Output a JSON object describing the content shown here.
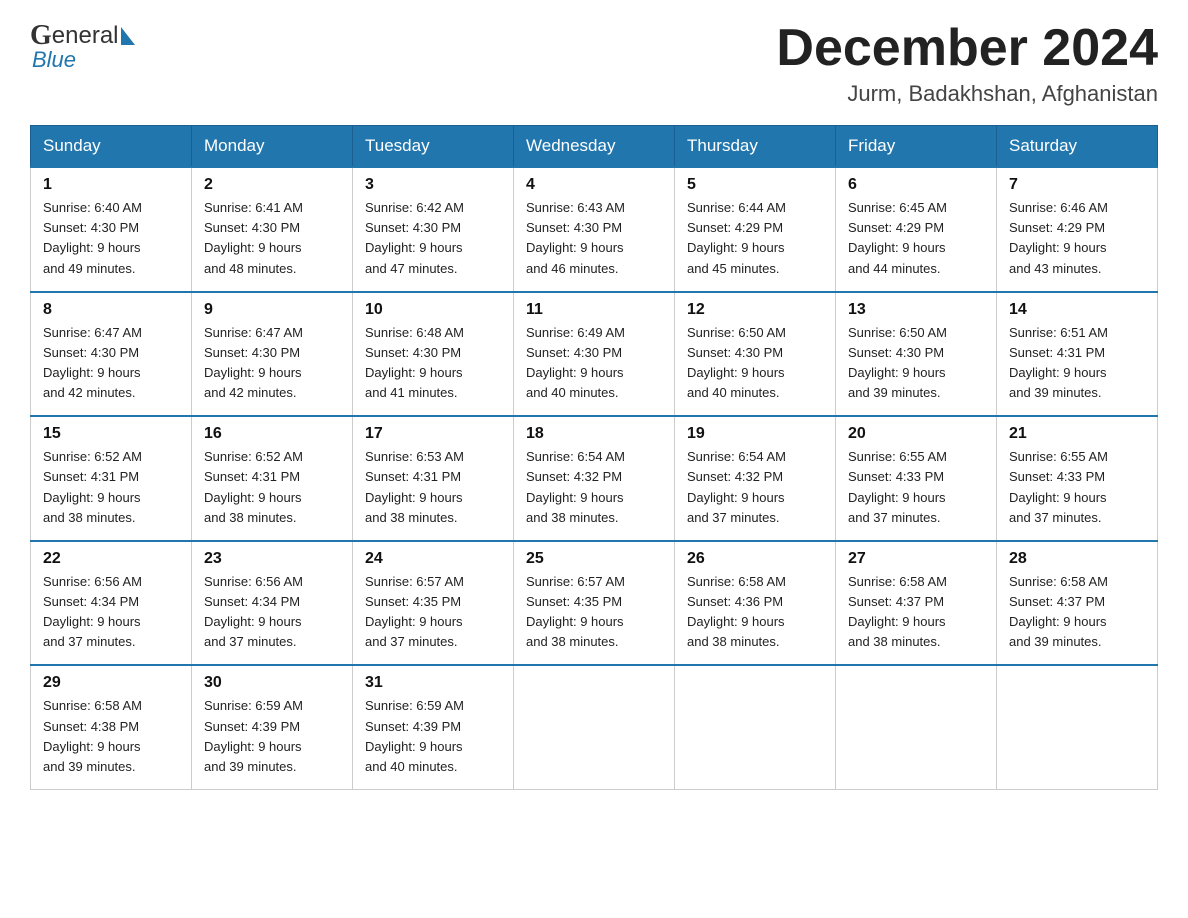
{
  "header": {
    "month_year": "December 2024",
    "location": "Jurm, Badakhshan, Afghanistan",
    "logo_general": "General",
    "logo_blue": "Blue"
  },
  "days_of_week": [
    "Sunday",
    "Monday",
    "Tuesday",
    "Wednesday",
    "Thursday",
    "Friday",
    "Saturday"
  ],
  "weeks": [
    [
      {
        "date": "1",
        "sunrise": "6:40 AM",
        "sunset": "4:30 PM",
        "daylight": "9 hours and 49 minutes."
      },
      {
        "date": "2",
        "sunrise": "6:41 AM",
        "sunset": "4:30 PM",
        "daylight": "9 hours and 48 minutes."
      },
      {
        "date": "3",
        "sunrise": "6:42 AM",
        "sunset": "4:30 PM",
        "daylight": "9 hours and 47 minutes."
      },
      {
        "date": "4",
        "sunrise": "6:43 AM",
        "sunset": "4:30 PM",
        "daylight": "9 hours and 46 minutes."
      },
      {
        "date": "5",
        "sunrise": "6:44 AM",
        "sunset": "4:29 PM",
        "daylight": "9 hours and 45 minutes."
      },
      {
        "date": "6",
        "sunrise": "6:45 AM",
        "sunset": "4:29 PM",
        "daylight": "9 hours and 44 minutes."
      },
      {
        "date": "7",
        "sunrise": "6:46 AM",
        "sunset": "4:29 PM",
        "daylight": "9 hours and 43 minutes."
      }
    ],
    [
      {
        "date": "8",
        "sunrise": "6:47 AM",
        "sunset": "4:30 PM",
        "daylight": "9 hours and 42 minutes."
      },
      {
        "date": "9",
        "sunrise": "6:47 AM",
        "sunset": "4:30 PM",
        "daylight": "9 hours and 42 minutes."
      },
      {
        "date": "10",
        "sunrise": "6:48 AM",
        "sunset": "4:30 PM",
        "daylight": "9 hours and 41 minutes."
      },
      {
        "date": "11",
        "sunrise": "6:49 AM",
        "sunset": "4:30 PM",
        "daylight": "9 hours and 40 minutes."
      },
      {
        "date": "12",
        "sunrise": "6:50 AM",
        "sunset": "4:30 PM",
        "daylight": "9 hours and 40 minutes."
      },
      {
        "date": "13",
        "sunrise": "6:50 AM",
        "sunset": "4:30 PM",
        "daylight": "9 hours and 39 minutes."
      },
      {
        "date": "14",
        "sunrise": "6:51 AM",
        "sunset": "4:31 PM",
        "daylight": "9 hours and 39 minutes."
      }
    ],
    [
      {
        "date": "15",
        "sunrise": "6:52 AM",
        "sunset": "4:31 PM",
        "daylight": "9 hours and 38 minutes."
      },
      {
        "date": "16",
        "sunrise": "6:52 AM",
        "sunset": "4:31 PM",
        "daylight": "9 hours and 38 minutes."
      },
      {
        "date": "17",
        "sunrise": "6:53 AM",
        "sunset": "4:31 PM",
        "daylight": "9 hours and 38 minutes."
      },
      {
        "date": "18",
        "sunrise": "6:54 AM",
        "sunset": "4:32 PM",
        "daylight": "9 hours and 38 minutes."
      },
      {
        "date": "19",
        "sunrise": "6:54 AM",
        "sunset": "4:32 PM",
        "daylight": "9 hours and 37 minutes."
      },
      {
        "date": "20",
        "sunrise": "6:55 AM",
        "sunset": "4:33 PM",
        "daylight": "9 hours and 37 minutes."
      },
      {
        "date": "21",
        "sunrise": "6:55 AM",
        "sunset": "4:33 PM",
        "daylight": "9 hours and 37 minutes."
      }
    ],
    [
      {
        "date": "22",
        "sunrise": "6:56 AM",
        "sunset": "4:34 PM",
        "daylight": "9 hours and 37 minutes."
      },
      {
        "date": "23",
        "sunrise": "6:56 AM",
        "sunset": "4:34 PM",
        "daylight": "9 hours and 37 minutes."
      },
      {
        "date": "24",
        "sunrise": "6:57 AM",
        "sunset": "4:35 PM",
        "daylight": "9 hours and 37 minutes."
      },
      {
        "date": "25",
        "sunrise": "6:57 AM",
        "sunset": "4:35 PM",
        "daylight": "9 hours and 38 minutes."
      },
      {
        "date": "26",
        "sunrise": "6:58 AM",
        "sunset": "4:36 PM",
        "daylight": "9 hours and 38 minutes."
      },
      {
        "date": "27",
        "sunrise": "6:58 AM",
        "sunset": "4:37 PM",
        "daylight": "9 hours and 38 minutes."
      },
      {
        "date": "28",
        "sunrise": "6:58 AM",
        "sunset": "4:37 PM",
        "daylight": "9 hours and 39 minutes."
      }
    ],
    [
      {
        "date": "29",
        "sunrise": "6:58 AM",
        "sunset": "4:38 PM",
        "daylight": "9 hours and 39 minutes."
      },
      {
        "date": "30",
        "sunrise": "6:59 AM",
        "sunset": "4:39 PM",
        "daylight": "9 hours and 39 minutes."
      },
      {
        "date": "31",
        "sunrise": "6:59 AM",
        "sunset": "4:39 PM",
        "daylight": "9 hours and 40 minutes."
      },
      null,
      null,
      null,
      null
    ]
  ],
  "labels": {
    "sunrise": "Sunrise:",
    "sunset": "Sunset:",
    "daylight": "Daylight:"
  },
  "colors": {
    "header_bg": "#2176ae",
    "header_text": "#ffffff",
    "border": "#2176ae",
    "body_text": "#222222"
  }
}
